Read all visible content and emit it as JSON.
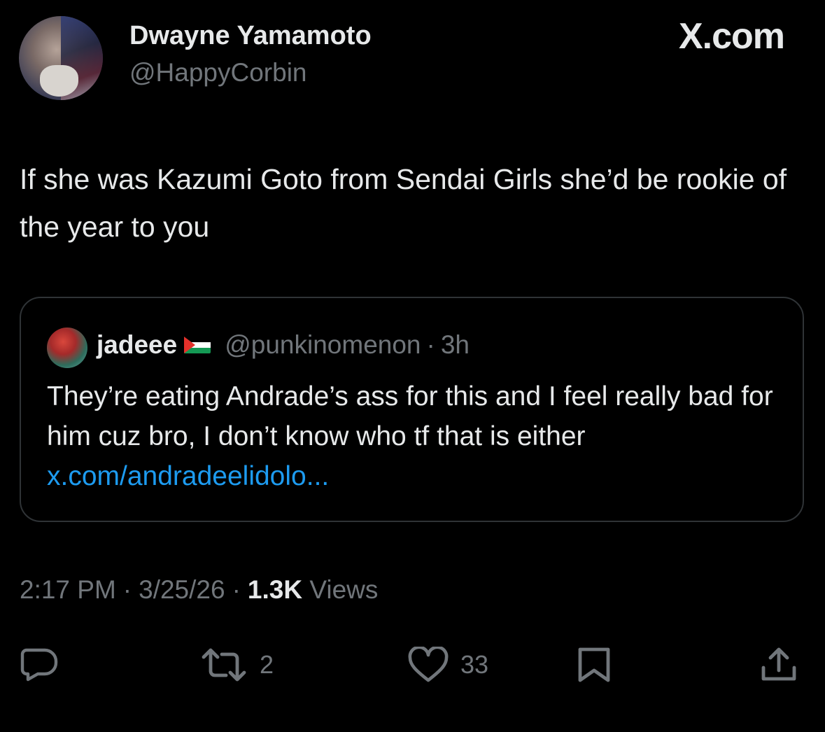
{
  "app": {
    "brand": "X.com"
  },
  "tweet": {
    "author": {
      "display_name": "Dwayne Yamamoto",
      "handle": "@HappyCorbin"
    },
    "text": "If she was Kazumi Goto from Sendai Girls she’d be rookie of the year to you",
    "quoted": {
      "display_name": "jadeee",
      "flag_icon": "palestine-flag-icon",
      "handle": "@punkinomenon",
      "separator": "·",
      "time": "3h",
      "text": "They’re eating Andrade’s ass for this and I feel really bad for him cuz bro, I don’t know who tf that is either ",
      "link": "x.com/andradeelidolo..."
    },
    "meta": {
      "time": "2:17 PM",
      "date": "3/25/26",
      "separator": "·",
      "views_count": "1.3K",
      "views_label": "Views"
    },
    "actions": {
      "reply_icon": "reply-icon",
      "repost_icon": "repost-icon",
      "repost_count": "2",
      "like_icon": "heart-icon",
      "like_count": "33",
      "bookmark_icon": "bookmark-icon",
      "share_icon": "share-icon"
    }
  },
  "colors": {
    "background": "#000000",
    "text_primary": "#e7e9ea",
    "text_secondary": "#71767b",
    "link": "#1d9bf0",
    "border": "#2f3336"
  }
}
